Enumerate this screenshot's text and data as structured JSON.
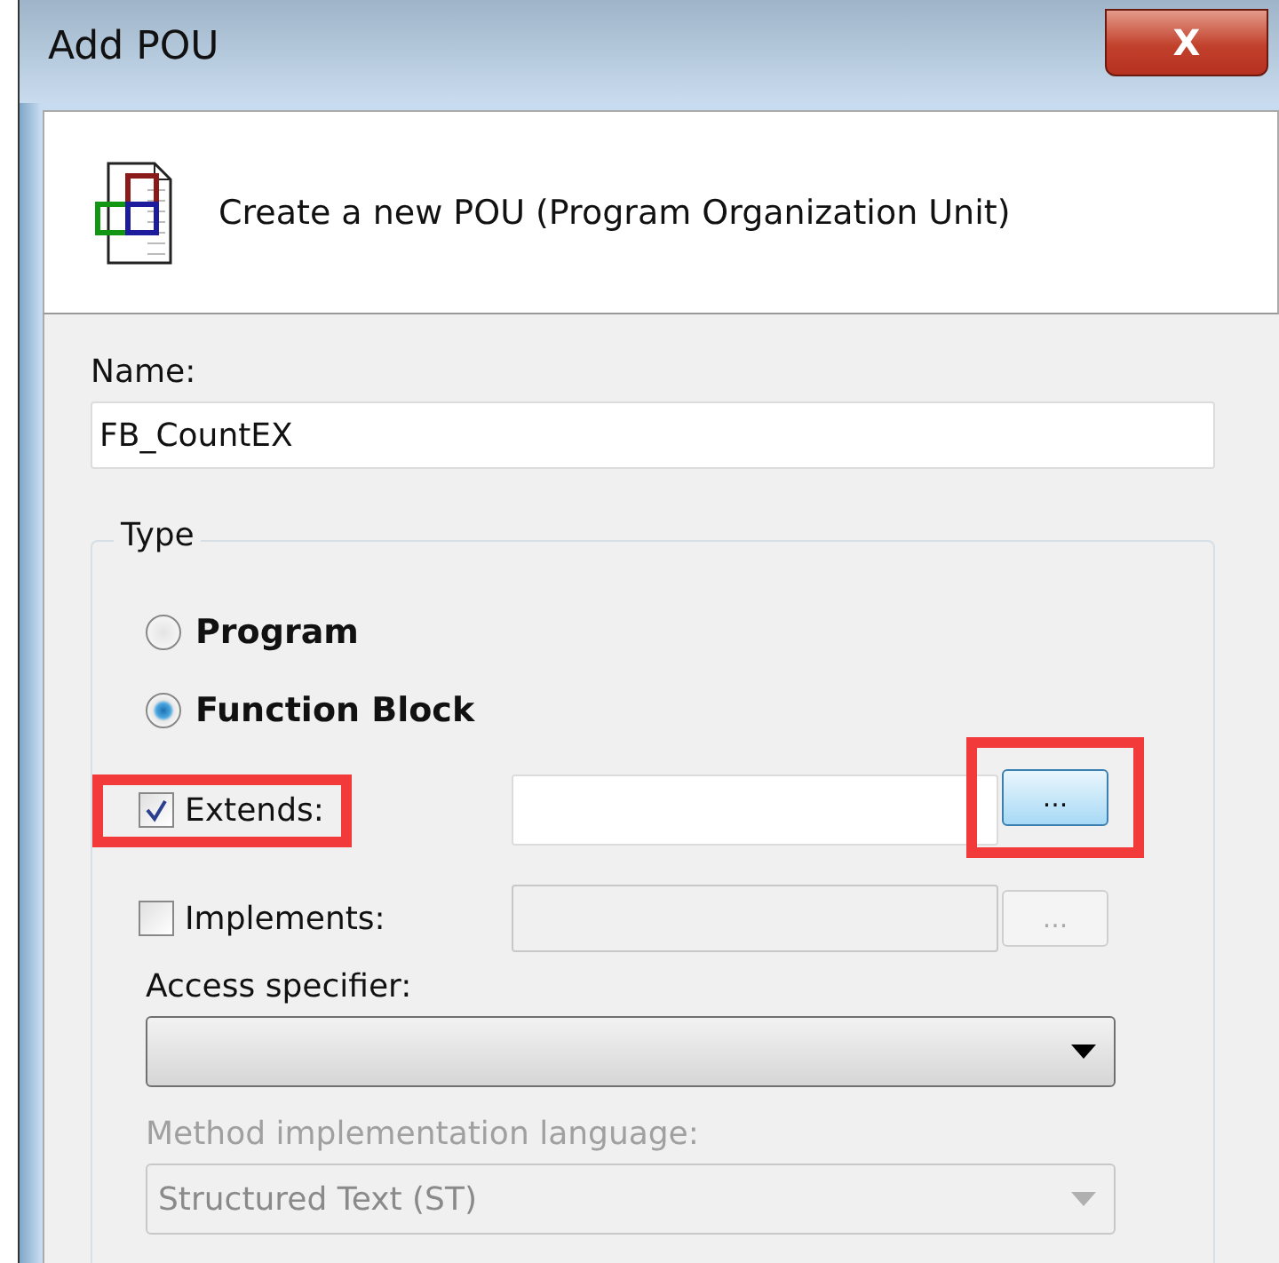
{
  "window": {
    "title": "Add POU",
    "close_label": "X"
  },
  "header": {
    "text": "Create a new POU (Program Organization Unit)"
  },
  "name": {
    "label": "Name:",
    "value": "FB_CountEX"
  },
  "type": {
    "legend": "Type",
    "options": [
      {
        "label": "Program",
        "selected": false
      },
      {
        "label": "Function Block",
        "selected": true
      }
    ],
    "inherit": [
      {
        "label": "Extends:",
        "checked": true,
        "disabled": false,
        "highlighted": true,
        "button": "...",
        "button_highlighted": true
      },
      {
        "label": "Implements:",
        "checked": false,
        "disabled": true,
        "highlighted": false,
        "button": "...",
        "button_highlighted": false
      }
    ],
    "access": {
      "label": "Access specifier:",
      "disabled": false
    },
    "method": {
      "label": "Method implementation language:",
      "value": "Structured Text (ST)",
      "disabled": true
    }
  }
}
